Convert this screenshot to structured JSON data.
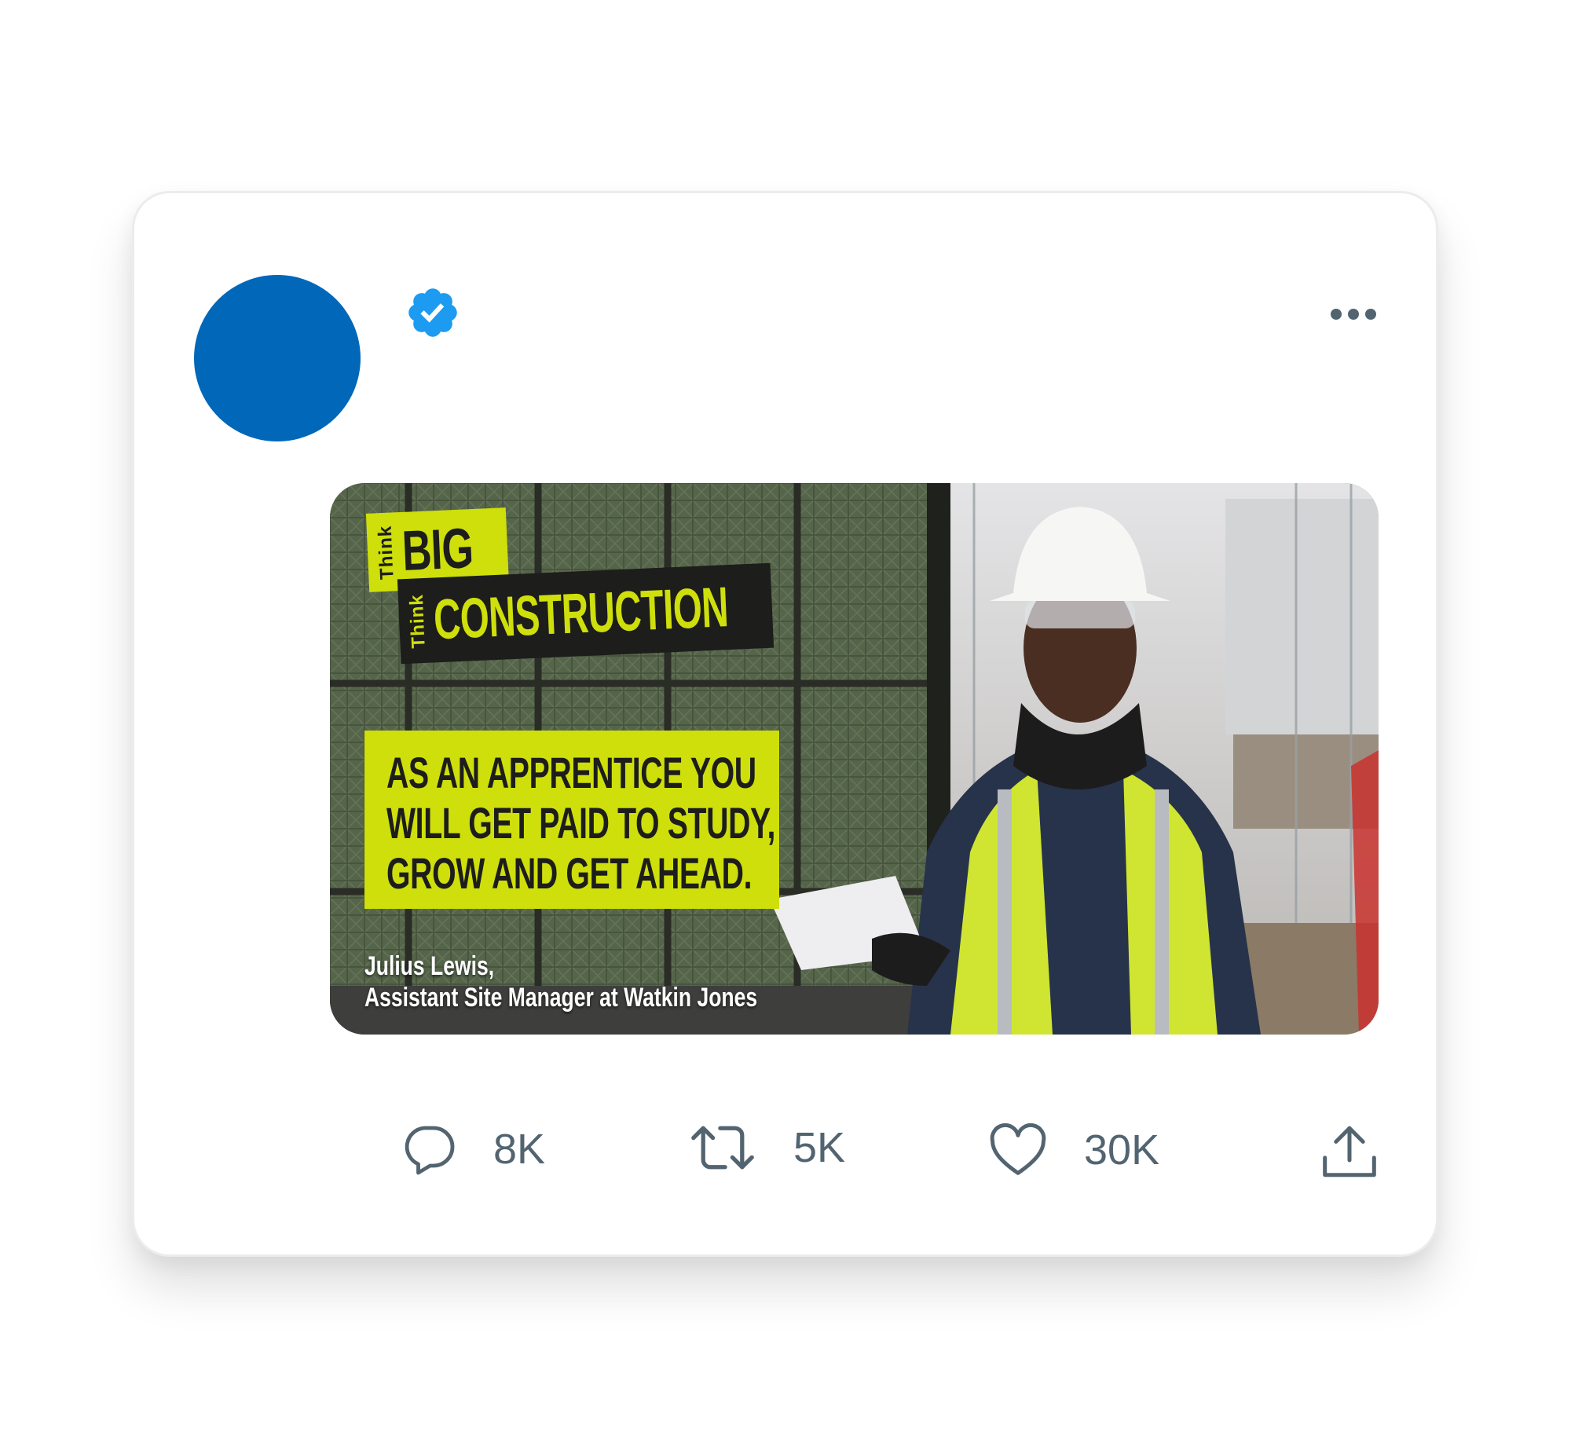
{
  "tweet": {
    "avatar_color": "#0067b9",
    "verified_badge": "verified-badge-icon",
    "more_menu": "more-horizontal-icon",
    "media": {
      "tag_think_1": "Think",
      "tag_big": "BIG",
      "tag_think_2": "Think",
      "tag_construction": "CONSTRUCTION",
      "quote_lines": [
        "AS AN APPRENTICE YOU",
        "WILL GET PAID TO STUDY,",
        "GROW AND GET AHEAD."
      ],
      "caption_name": "Julius Lewis,",
      "caption_role": "Assistant Site Manager at Watkin Jones",
      "accent_color": "#cedf0b"
    },
    "actions": {
      "reply": {
        "icon": "reply-icon",
        "count": "8K"
      },
      "retweet": {
        "icon": "retweet-icon",
        "count": "5K"
      },
      "like": {
        "icon": "heart-icon",
        "count": "30K"
      },
      "share": {
        "icon": "share-icon"
      }
    }
  }
}
